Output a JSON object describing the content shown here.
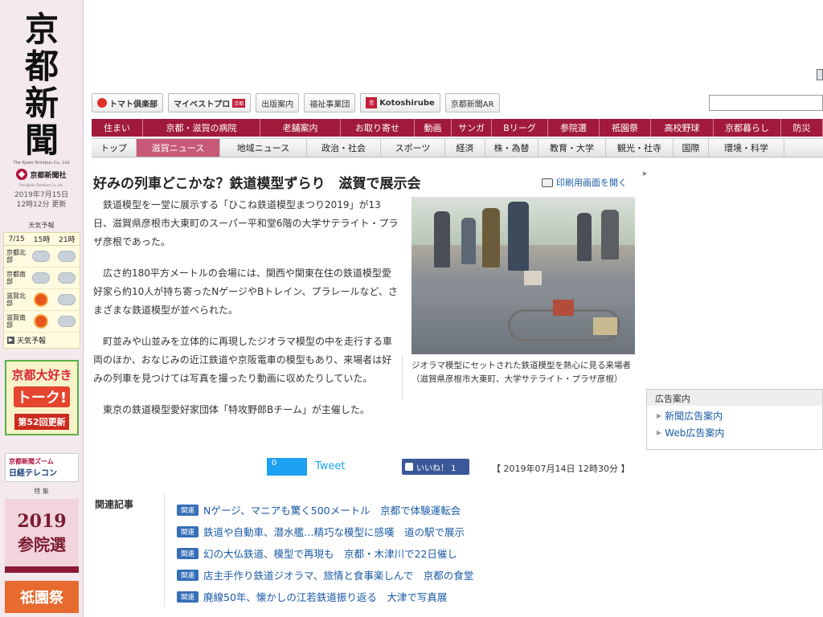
{
  "masthead": {
    "logo_chars": [
      "京",
      "都",
      "新",
      "聞"
    ],
    "logo_en": "The Kyoto Shimbun Co., Ltd.",
    "corp_name": "京都新聞社",
    "corp_en": "The Kyoto Shimbun Co.,Ltd.",
    "date_line1": "2019年7月15日",
    "date_line2": "12時12分 更新"
  },
  "weather": {
    "title": "天気予報",
    "headers": [
      "7/15",
      "15時",
      "21時"
    ],
    "rows": [
      {
        "region": "京都北部",
        "icons": [
          "cloud-icon",
          "cloud-icon"
        ]
      },
      {
        "region": "京都南部",
        "icons": [
          "cloud-icon",
          "cloud-icon"
        ]
      },
      {
        "region": "滋賀北部",
        "icons": [
          "sun-icon",
          "cloud-icon"
        ]
      },
      {
        "region": "滋賀南部",
        "icons": [
          "sun-icon",
          "cloud-icon"
        ]
      }
    ],
    "link": "天気予報"
  },
  "side_banners": {
    "talk_line1": "京都大好き",
    "talk_line2": "トーク!",
    "talk_line3": "第52回更新",
    "nikkei_line1": "京都新聞ズーム",
    "nikkei_line2": "日経テレコン",
    "special_label": "特 集",
    "election_line1": "2019",
    "election_line2": "参院選",
    "gion": "祇園祭"
  },
  "top_links": [
    "トマト倶楽部",
    "マイベストプロ",
    "出版案内",
    "福祉事業団",
    "Kotoshirube",
    "京都新聞AR"
  ],
  "top_links_extra": {
    "mybest_badge": "京都",
    "koto_mark": "言"
  },
  "nav_primary": [
    "住まい",
    "京都・滋賀の病院",
    "老舗案内",
    "お取り寄せ",
    "動画",
    "サンガ",
    "Bリーグ",
    "参院選",
    "祇園祭",
    "高校野球",
    "京都暮らし",
    "防災"
  ],
  "nav_secondary": [
    "トップ",
    "滋賀ニュース",
    "地域ニュース",
    "政治・社会",
    "スポーツ",
    "経済",
    "株・為替",
    "教育・大学",
    "観光・社寺",
    "国際",
    "環境・科学"
  ],
  "article": {
    "headline": "好みの列車どこかな？鉄道模型ずらり　滋賀で展示会",
    "print_label": "印刷用画面を開く",
    "paragraphs": [
      "鉄道模型を一堂に展示する「ひこね鉄道模型まつり2019」が13日、滋賀県彦根市大東町のスーパー平和堂6階の大学サテライト・プラザ彦根であった。",
      "広さ約180平方メートルの会場には、関西や関東在住の鉄道模型愛好家ら約10人が持ち寄ったNゲージやBトレイン、プラレールなど、さまざまな鉄道模型が並べられた。",
      "町並みや山並みを立体的に再現したジオラマ模型の中を走行する車両のほか、おなじみの近江鉄道や京阪電車の模型もあり、来場者は好みの列車を見つけては写真を撮ったり動画に収めたりしていた。",
      "東京の鉄道模型愛好家団体「特攻野郎Bチーム」が主催した。"
    ],
    "caption": "ジオラマ模型にセットされた鉄道模型を熱心に見る来場者（滋賀県彦根市大東町、大学サテライト・プラザ彦根）",
    "tweet_count": "0",
    "tweet_label": "Tweet",
    "like_label": "いいね！ 1",
    "timestamp": "【 2019年07月14日 12時30分 】"
  },
  "ads": {
    "title": "広告案内",
    "links": [
      "新聞広告案内",
      "Web広告案内"
    ]
  },
  "related": {
    "title": "関連記事",
    "badge": "関連",
    "items": [
      "Nゲージ、マニアも驚く500メートル　京都で体験運転会",
      "鉄道や自動車、潜水艦…精巧な模型に感嘆　道の駅で展示",
      "幻の大仏鉄道、模型で再現も　京都・木津川で22日催し",
      "店主手作り鉄道ジオラマ、旅情と食事楽しんで　京都の食堂",
      "廃線50年、懐かしの江若鉄道振り返る　大津で写真展"
    ]
  },
  "colors": {
    "brand": "#a11a3c",
    "link": "#1a5aa6",
    "active_tab": "#c85a78"
  }
}
